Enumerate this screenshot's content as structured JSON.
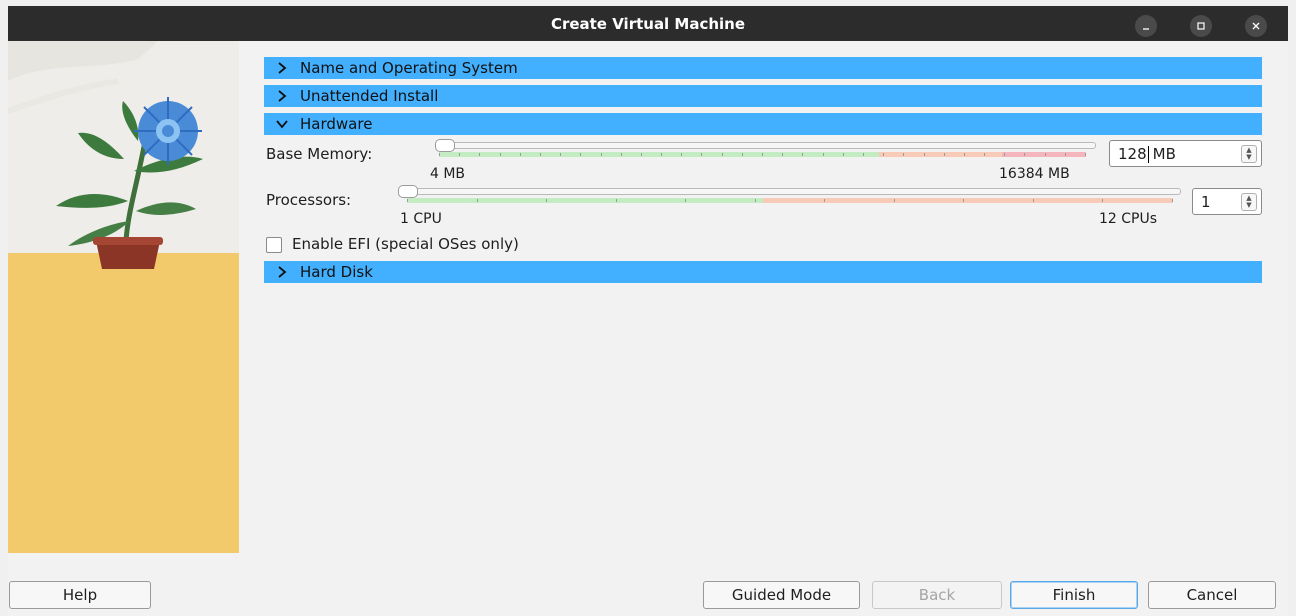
{
  "window": {
    "title": "Create Virtual Machine"
  },
  "sections": [
    {
      "label": "Name and Operating System",
      "expanded": false
    },
    {
      "label": "Unattended Install",
      "expanded": false
    },
    {
      "label": "Hardware",
      "expanded": true
    },
    {
      "label": "Hard Disk",
      "expanded": false
    }
  ],
  "hardware": {
    "memory": {
      "label": "Base Memory:",
      "min_label": "4 MB",
      "max_label": "16384 MB",
      "value": "128",
      "unit": "MB",
      "fraction": 0.0076
    },
    "processors": {
      "label": "Processors:",
      "min_label": "1 CPU",
      "max_label": "12 CPUs",
      "value": "1",
      "fraction": 0
    },
    "efi": {
      "label": "Enable EFI (special OSes only)",
      "checked": false
    }
  },
  "footer": {
    "help": "Help",
    "guided_mode": "Guided Mode",
    "back": "Back",
    "finish": "Finish",
    "cancel": "Cancel"
  },
  "colors": {
    "header_blue": "#42b0ff",
    "titlebar": "#2c2c2c",
    "scale_green": "#c3ecc3",
    "scale_orange": "#f8cbb8",
    "scale_red": "#f5b5bd"
  }
}
